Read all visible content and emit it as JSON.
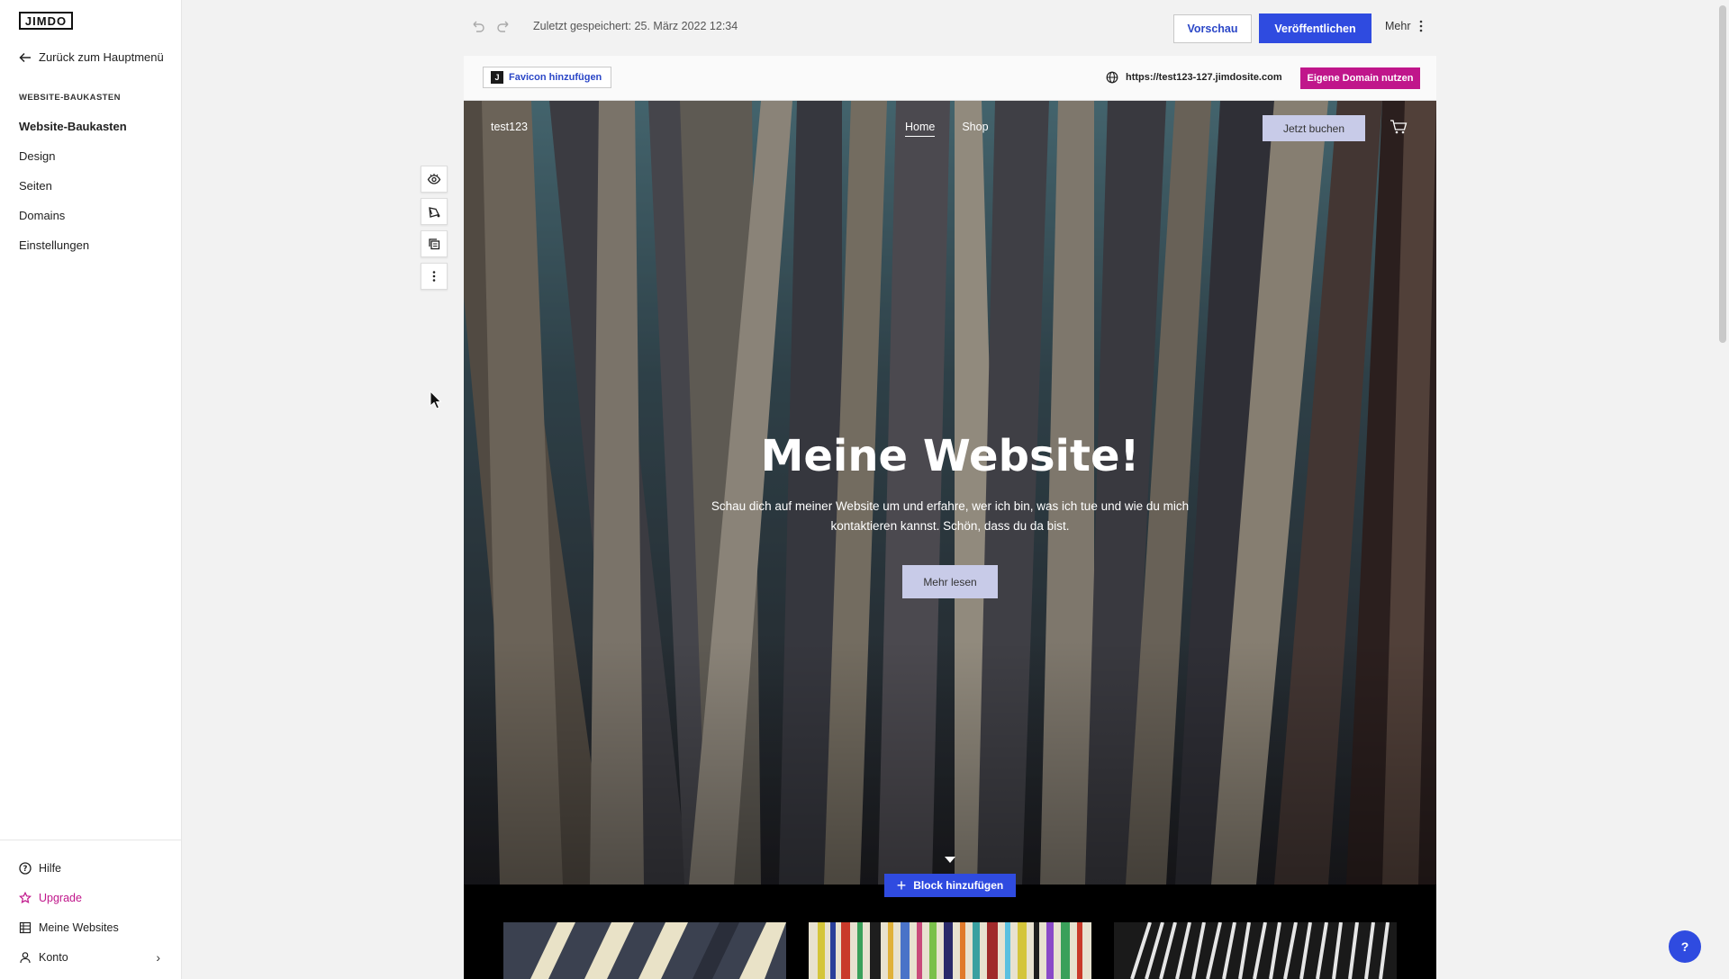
{
  "sidebar": {
    "logo": "JIMDO",
    "back_label": "Zurück zum Hauptmenü",
    "section_label": "WEBSITE-BAUKASTEN",
    "items": [
      {
        "label": "Website-Baukasten"
      },
      {
        "label": "Design"
      },
      {
        "label": "Seiten"
      },
      {
        "label": "Domains"
      },
      {
        "label": "Einstellungen"
      }
    ],
    "bottom": [
      {
        "label": "Hilfe"
      },
      {
        "label": "Upgrade"
      },
      {
        "label": "Meine Websites"
      },
      {
        "label": "Konto"
      }
    ]
  },
  "toolbar": {
    "saved_text": "Zuletzt gespeichert: 25. März 2022 12:34",
    "preview_label": "Vorschau",
    "publish_label": "Veröffentlichen",
    "more_label": "Mehr"
  },
  "sitebar": {
    "favicon_label": "Favicon hinzufügen",
    "url": "https://test123-127.jimdosite.com",
    "domain_btn": "Eigene Domain nutzen"
  },
  "site": {
    "name": "test123",
    "nav": [
      {
        "label": "Home"
      },
      {
        "label": "Shop"
      }
    ],
    "book_label": "Jetzt buchen",
    "hero_title": "Meine Website!",
    "hero_sub": "Schau dich auf meiner Website um und erfahre, wer ich bin, was ich tue und wie du mich kontaktieren kannst. Schön, dass du da bist.",
    "hero_btn": "Mehr lesen"
  },
  "block_add_label": "Block hinzufügen",
  "help_label": "?",
  "colors": {
    "accent_blue": "#2f4be0",
    "accent_magenta": "#c0168b"
  }
}
